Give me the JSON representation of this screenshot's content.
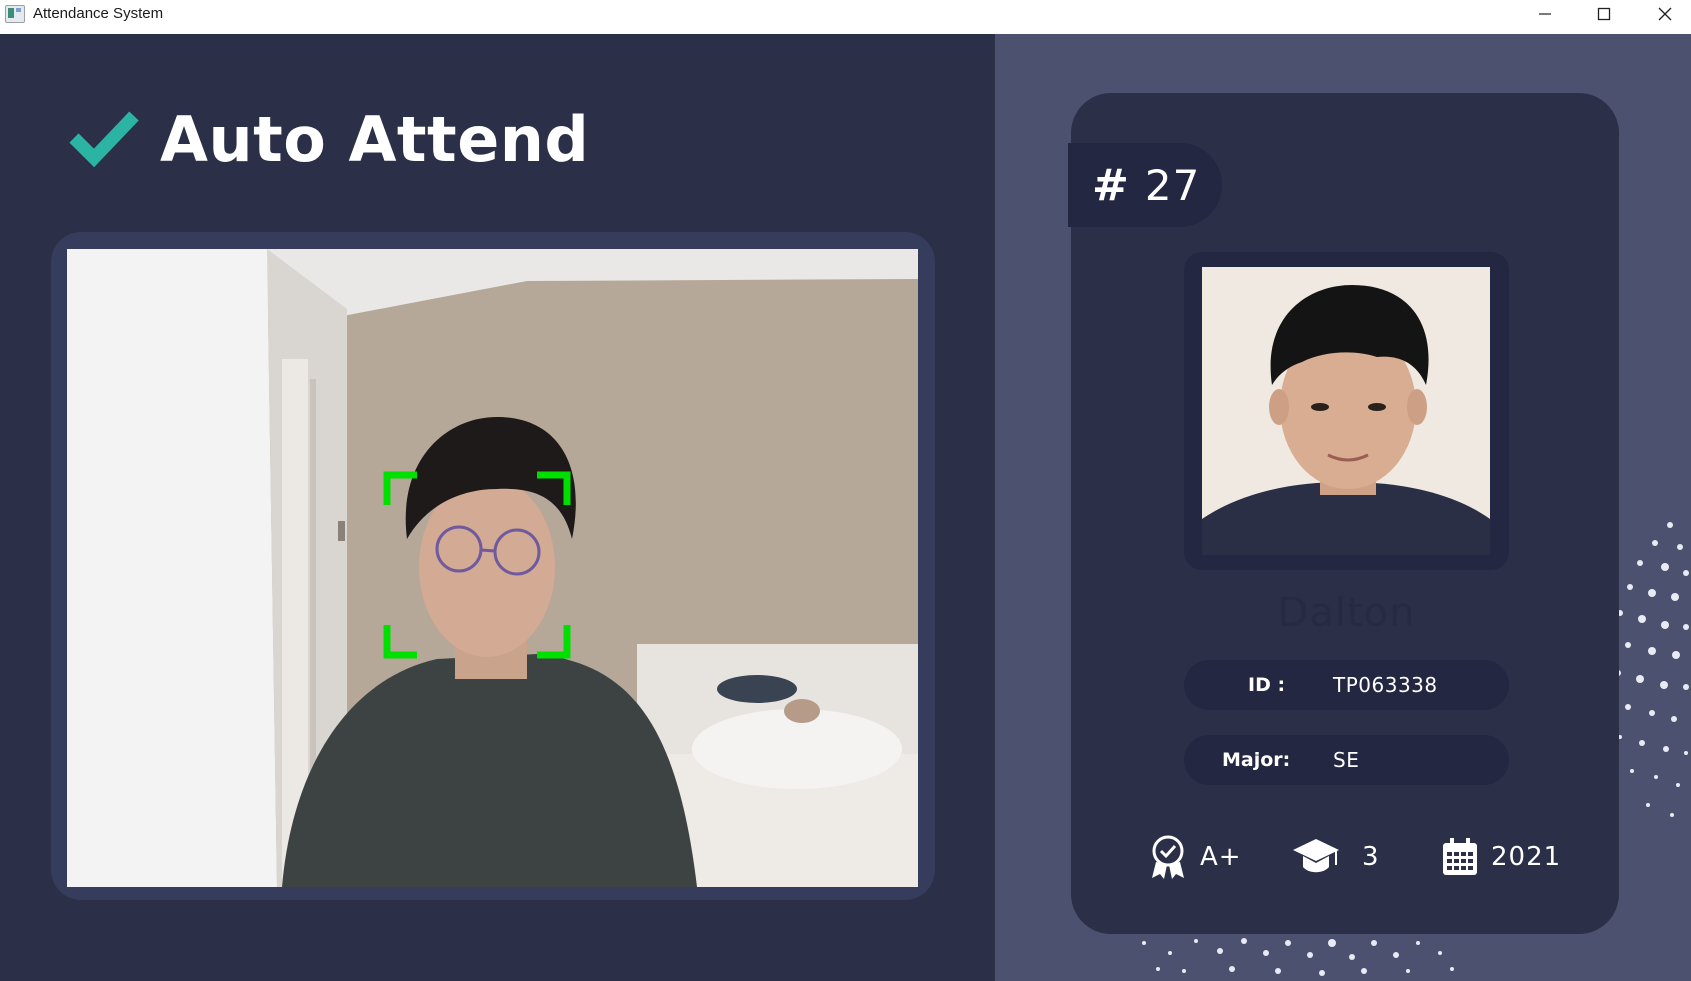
{
  "window": {
    "title": "Attendance System",
    "controls": [
      "minimize-icon",
      "maximize-icon",
      "close-icon"
    ]
  },
  "header": {
    "logo_icon": "checkmark-icon",
    "title": "Auto Attend"
  },
  "camera": {
    "detection_box_color": "#00e000"
  },
  "student": {
    "count_label": "#",
    "count_value": "27",
    "name": "Dalton",
    "id_label": "ID :",
    "id_value": "TP063338",
    "major_label": "Major:",
    "major_value": "SE",
    "grade_icon": "award-ribbon-icon",
    "grade": "A+",
    "year_icon": "graduation-cap-icon",
    "year": "3",
    "start_icon": "calendar-icon",
    "starting_year": "2021"
  },
  "colors": {
    "dark_bg": "#2b2f47",
    "side_bg": "#4c516f",
    "accent": "#2bb3a3"
  }
}
